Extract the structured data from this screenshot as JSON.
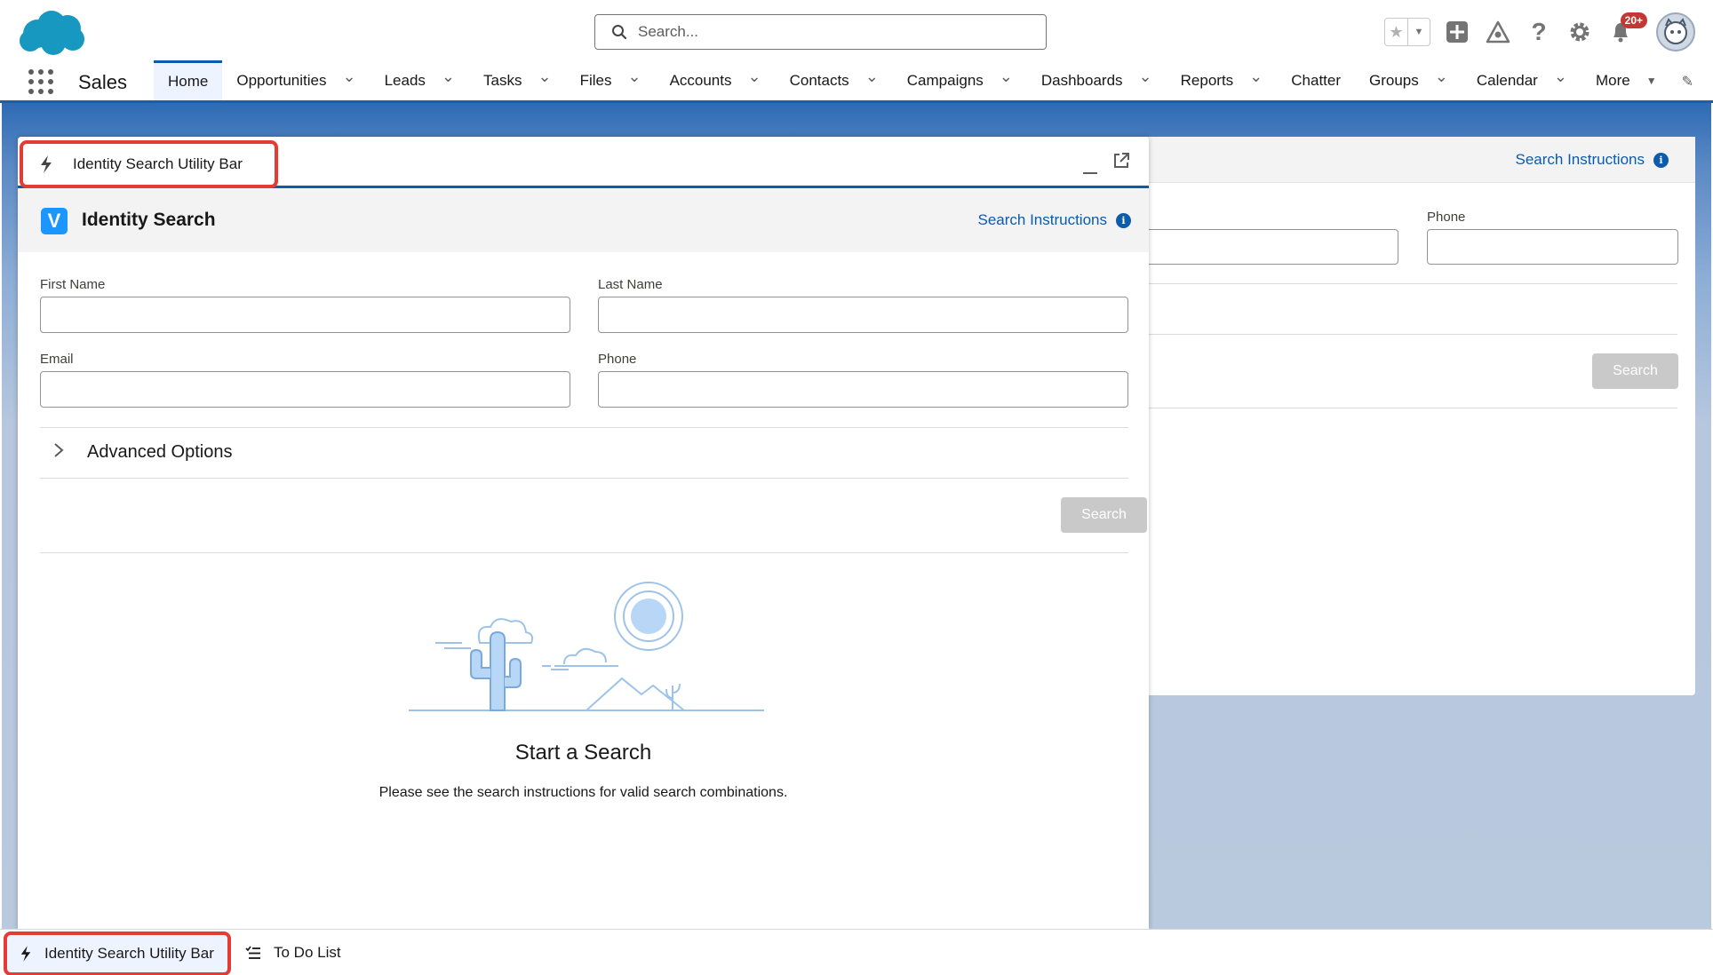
{
  "global_header": {
    "search_placeholder": "Search...",
    "notification_badge": "20+",
    "icons": [
      "salesforce-cloud-logo",
      "search-icon",
      "star-icon",
      "chevron-down-icon",
      "plus-icon",
      "trailhead-icon",
      "help-icon",
      "gear-icon",
      "bell-icon",
      "avatar"
    ]
  },
  "nav": {
    "app_name": "Sales",
    "items": [
      {
        "label": "Home",
        "dropdown": false,
        "active": true
      },
      {
        "label": "Opportunities",
        "dropdown": true
      },
      {
        "label": "Leads",
        "dropdown": true
      },
      {
        "label": "Tasks",
        "dropdown": true
      },
      {
        "label": "Files",
        "dropdown": true
      },
      {
        "label": "Accounts",
        "dropdown": true
      },
      {
        "label": "Contacts",
        "dropdown": true
      },
      {
        "label": "Campaigns",
        "dropdown": true
      },
      {
        "label": "Dashboards",
        "dropdown": true
      },
      {
        "label": "Reports",
        "dropdown": true
      },
      {
        "label": "Chatter",
        "dropdown": false
      },
      {
        "label": "Groups",
        "dropdown": true
      },
      {
        "label": "Calendar",
        "dropdown": true
      },
      {
        "label": "More",
        "dropdown": true
      }
    ]
  },
  "background_card": {
    "search_instructions": "Search Instructions",
    "phone_label": "Phone",
    "search_button": "Search"
  },
  "utility_panel": {
    "header_title": "Identity Search Utility Bar",
    "component_title": "Identity Search",
    "component_logo": "V",
    "search_instructions": "Search Instructions",
    "fields": {
      "first_name_label": "First Name",
      "last_name_label": "Last Name",
      "email_label": "Email",
      "phone_label": "Phone"
    },
    "advanced_options": "Advanced Options",
    "search_button": "Search",
    "empty_state": {
      "title": "Start a Search",
      "message": "Please see the search instructions for valid search combinations."
    }
  },
  "utility_bar": {
    "items": [
      {
        "label": "Identity Search Utility Bar",
        "icon": "lightning-bolt-icon",
        "active": true
      },
      {
        "label": "To Do List",
        "icon": "task-list-icon",
        "active": false
      }
    ]
  },
  "colors": {
    "brand_blue": "#0b5cab",
    "highlight_red": "#e53b35",
    "disabled_button": "#c9c9c9",
    "page_background": "#b9c9de"
  }
}
